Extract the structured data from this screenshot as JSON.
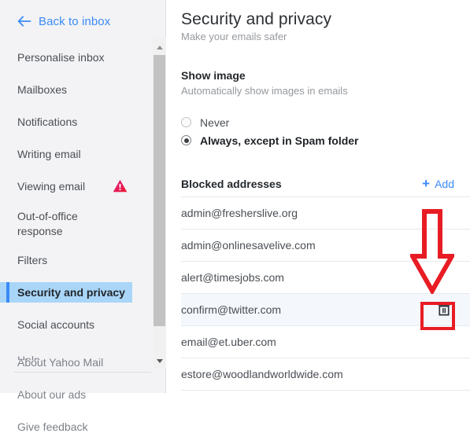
{
  "sidebar": {
    "back_link": {
      "label": "Back to inbox",
      "icon": "arrow-left-icon",
      "color": "#3a8bf7"
    },
    "items": [
      {
        "label": "Personalise inbox",
        "selected": false,
        "badge": null
      },
      {
        "label": "Mailboxes",
        "selected": false,
        "badge": null
      },
      {
        "label": "Notifications",
        "selected": false,
        "badge": null
      },
      {
        "label": "Writing email",
        "selected": false,
        "badge": null
      },
      {
        "label": "Viewing email",
        "selected": false,
        "badge": "warning-icon"
      },
      {
        "label": "Out-of-office\nresponse",
        "selected": false,
        "badge": null
      },
      {
        "label": "Filters",
        "selected": false,
        "badge": null
      },
      {
        "label": "Security and privacy",
        "selected": true,
        "badge": null
      },
      {
        "label": "Social accounts",
        "selected": false,
        "badge": null
      }
    ],
    "secondary_items": [
      {
        "label": "About Yahoo Mail"
      },
      {
        "label": "About our ads"
      },
      {
        "label": "Give feedback"
      }
    ],
    "clipped_item": {
      "label": "Help"
    },
    "selected_color": "#a9d6f8",
    "accent_color": "#3a8bf7",
    "scrollbar": {
      "up_icon": "triangle-up-icon",
      "down_icon": "triangle-down-icon",
      "thumb_color": "#c2c2c2"
    }
  },
  "main": {
    "title": "Security and privacy",
    "subtitle": "Make your emails safer",
    "show_image": {
      "title": "Show image",
      "subtitle": "Automatically show images in emails",
      "options": [
        {
          "label": "Never",
          "checked": false
        },
        {
          "label": "Always, except in Spam folder",
          "checked": true
        }
      ]
    },
    "blocked": {
      "title": "Blocked addresses",
      "add_label": "Add",
      "add_icon": "plus-icon",
      "delete_icon": "trash-icon",
      "rows": [
        {
          "address": "admin@fresherslive.org",
          "active": false
        },
        {
          "address": "admin@onlinesavelive.com",
          "active": false
        },
        {
          "address": "alert@timesjobs.com",
          "active": false
        },
        {
          "address": "confirm@twitter.com",
          "active": true
        },
        {
          "address": "email@et.uber.com",
          "active": false
        },
        {
          "address": "estore@woodlandworldwide.com",
          "active": false
        }
      ]
    }
  },
  "annotations": {
    "color": "#e81c24",
    "arrow": "down-arrow-annotation",
    "highlight_box": "delete-button-highlight-box"
  }
}
